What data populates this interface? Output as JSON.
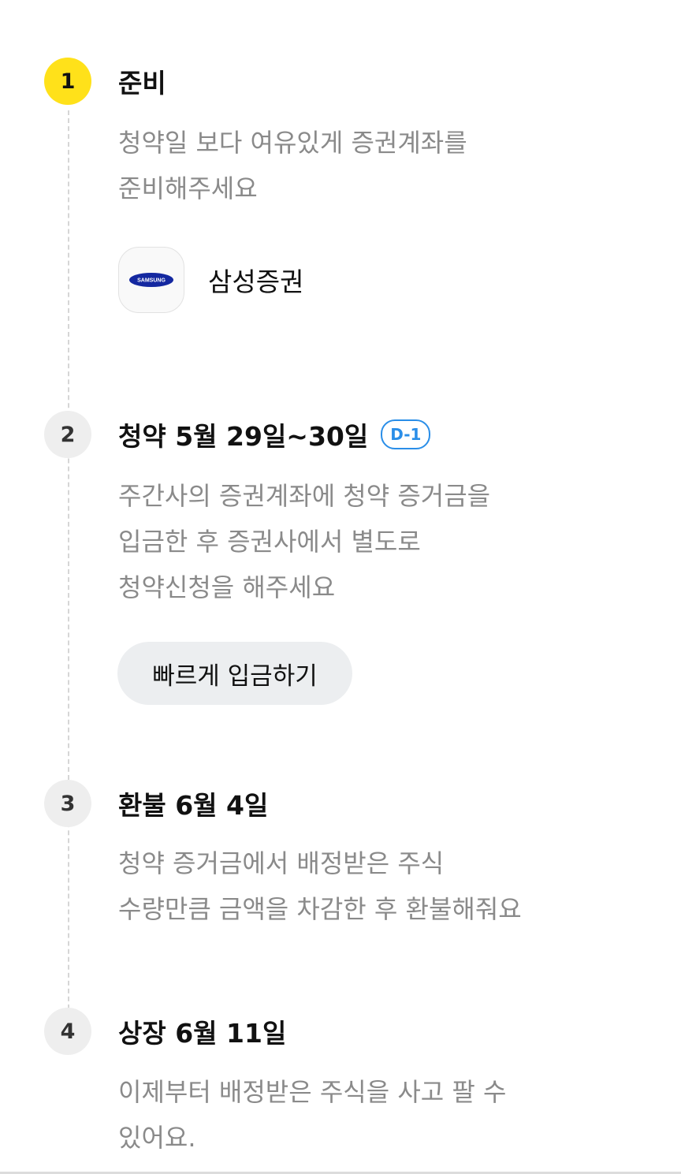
{
  "steps": [
    {
      "number": "1",
      "title": "준비",
      "description": [
        "청약일 보다 여유있게 증권계좌를",
        "준비해주세요"
      ],
      "active": true
    },
    {
      "number": "2",
      "title": "청약 5월 29일~30일",
      "badge": "D-1",
      "description": [
        "주간사의 증권계좌에 청약 증거금을",
        "입금한 후 증권사에서 별도로",
        "청약신청을 해주세요"
      ],
      "button_label": "빠르게 입금하기"
    },
    {
      "number": "3",
      "title": "환불 6월 4일",
      "description": [
        "청약 증거금에서 배정받은 주식",
        "수량만큼 금액을 차감한 후 환불해줘요"
      ]
    },
    {
      "number": "4",
      "title": "상장 6월 11일",
      "description": [
        "이제부터 배정받은 주식을 사고 팔 수",
        "있어요."
      ]
    }
  ],
  "broker": {
    "name": "삼성증권",
    "logo_text": "SAMSUNG",
    "logo_icon": "samsung-logo"
  },
  "colors": {
    "active_step": "#ffe11a",
    "inactive_step": "#eeeeee",
    "badge": "#2a8ee8",
    "samsung_blue": "#1428a0",
    "description_text": "#8a8a8a"
  }
}
